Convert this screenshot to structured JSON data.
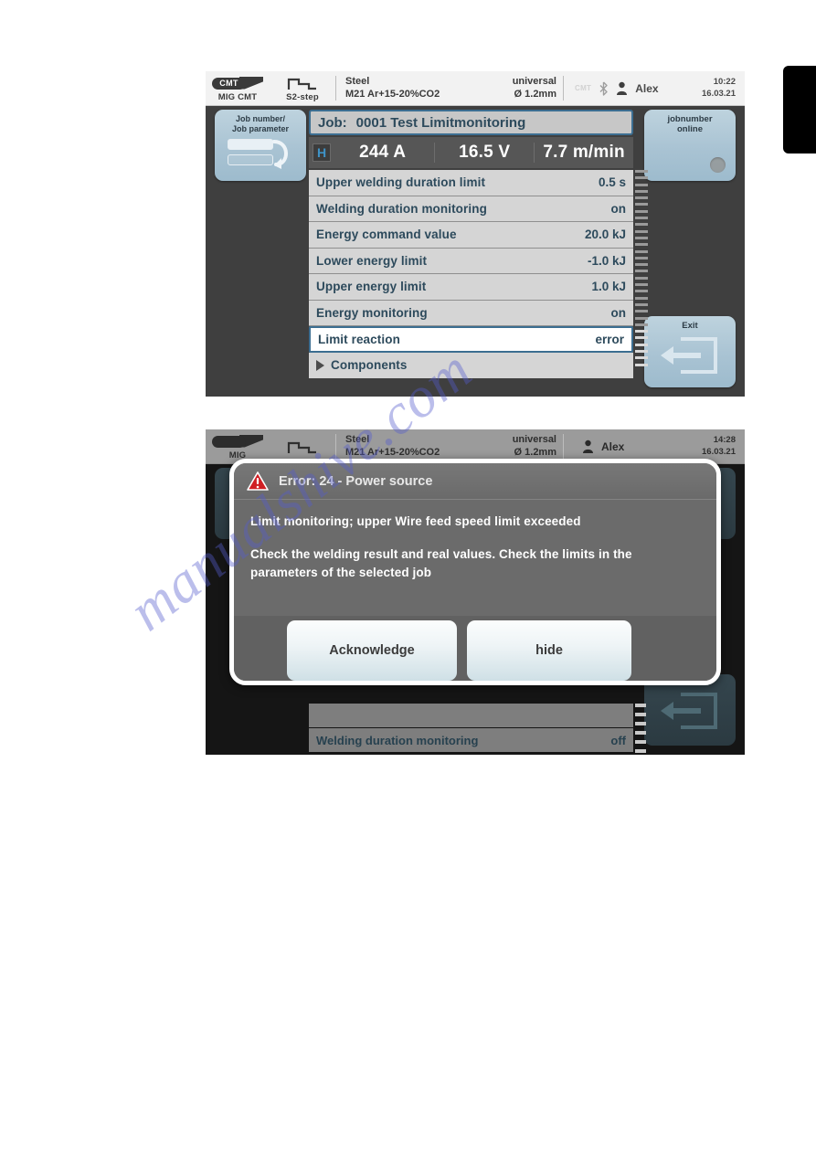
{
  "watermark": {
    "text": "manualshive.com"
  },
  "screens": [
    {
      "id": "screen-parameters",
      "header": {
        "mode_badge": "CMT",
        "mode_label": "MIG CMT",
        "step_label": "S2-step",
        "material_line1": "Steel",
        "material_line2": "M21 Ar+15-20%CO2",
        "wire_line1": "universal",
        "wire_line2": "Ø 1.2mm",
        "cmt_ghost": "CMT",
        "bluetooth_icon": "bluetooth-icon",
        "person_icon": "person-icon",
        "user": "Alex",
        "time": "10:22",
        "date": "16.03.21"
      },
      "left_key": {
        "label_line1": "Job number/",
        "label_line2": "Job parameter",
        "icon": "job-switch-icon"
      },
      "right_key_top": {
        "label_line1": "jobnumber",
        "label_line2": "online",
        "indicator": "status-dot"
      },
      "right_key_bottom": {
        "label": "Exit",
        "icon": "exit-arrow-icon"
      },
      "job_bar": {
        "label": "Job:",
        "value": "0001 Test Limitmonitoring"
      },
      "live_values": {
        "hold_indicator": "H",
        "current": "244 A",
        "voltage": "16.5 V",
        "wire_speed": "7.7 m/min"
      },
      "parameters": [
        {
          "name": "Upper welding duration limit",
          "value": "0.5 s",
          "selected": false
        },
        {
          "name": "Welding duration monitoring",
          "value": "on",
          "selected": false
        },
        {
          "name": "Energy command value",
          "value": "20.0 kJ",
          "selected": false
        },
        {
          "name": "Lower energy limit",
          "value": "-1.0 kJ",
          "selected": false
        },
        {
          "name": "Upper energy limit",
          "value": "1.0 kJ",
          "selected": false
        },
        {
          "name": "Energy monitoring",
          "value": "on",
          "selected": false
        },
        {
          "name": "Limit reaction",
          "value": "error",
          "selected": true
        }
      ],
      "group_row": {
        "name": "Components",
        "icon": "triangle-right-icon"
      }
    },
    {
      "id": "screen-error",
      "header": {
        "mode_badge": "",
        "mode_label": "MIG",
        "step_label": "",
        "material_line1": "Steel",
        "material_line2": "M21 Ar+15-20%CO2",
        "wire_line1": "universal",
        "wire_line2": "Ø 1.2mm",
        "cmt_ghost": "",
        "bluetooth_icon": "bluetooth-icon",
        "person_icon": "person-icon",
        "user": "Alex",
        "time": "14:28",
        "date": "16.03.21"
      },
      "background_rows": [
        {
          "name": "",
          "value": ""
        },
        {
          "name": "Welding duration monitoring",
          "value": "off"
        }
      ],
      "dialog": {
        "icon": "warning-triangle-icon",
        "title": "Error: 24 - Power source",
        "message_line1": "Limit monitoring; upper Wire feed speed limit exceeded",
        "message_line2": "Check the welding result and real values. Check the limits in the parameters of the selected job",
        "buttons": [
          {
            "label": "Acknowledge",
            "name": "acknowledge-button"
          },
          {
            "label": "hide",
            "name": "hide-button"
          }
        ]
      }
    }
  ],
  "colors": {
    "accent_blue": "#3c6e91",
    "text_blue": "#2d4a5c",
    "softkey": "#a9c3d3",
    "error_red": "#d01f24",
    "screen_bg": "#3f3f3f"
  }
}
